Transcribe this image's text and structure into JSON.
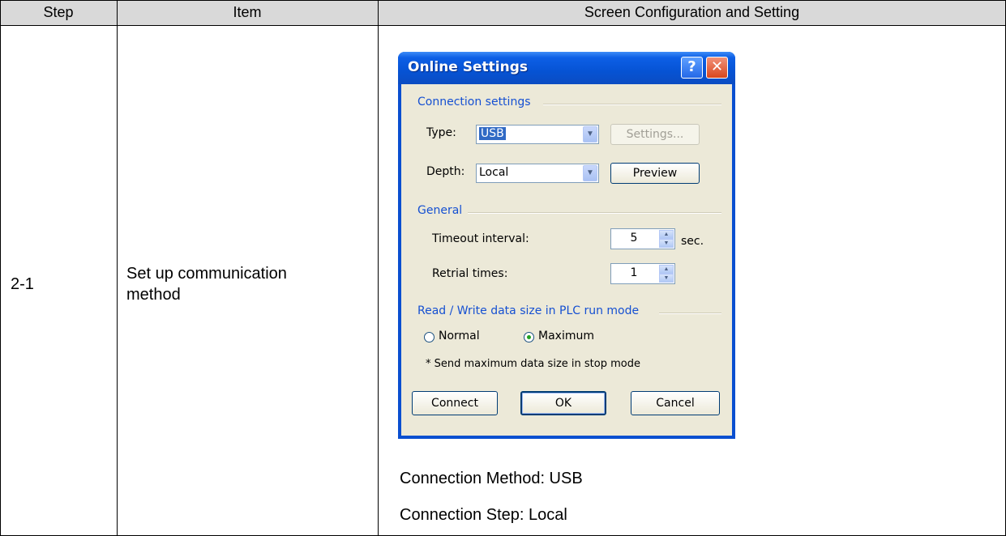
{
  "table": {
    "headers": [
      "Step",
      "Item",
      "Screen Configuration and Setting"
    ],
    "row": {
      "step": "2-1",
      "item_line1": "Set up communication",
      "item_line2": "method",
      "notes": [
        "Connection Method: USB",
        "Connection Step: Local"
      ]
    }
  },
  "dialog": {
    "title": "Online Settings",
    "help_glyph": "?",
    "close_glyph": "✕",
    "connection_settings": {
      "heading": "Connection settings",
      "type_label": "Type:",
      "type_value": "USB",
      "settings_button": "Settings...",
      "depth_label": "Depth:",
      "depth_value": "Local",
      "preview_button": "Preview"
    },
    "general": {
      "heading": "General",
      "timeout_label": "Timeout interval:",
      "timeout_value": "5",
      "timeout_unit": "sec.",
      "retrial_label": "Retrial times:",
      "retrial_value": "1"
    },
    "rw_mode": {
      "heading": "Read / Write data size in PLC run mode",
      "option_normal": "Normal",
      "option_maximum": "Maximum",
      "selected": "Maximum",
      "note": "* Send maximum data size in stop mode"
    },
    "buttons": {
      "connect": "Connect",
      "ok": "OK",
      "cancel": "Cancel"
    },
    "icons": {
      "combo_arrow": "chevron-down-icon",
      "spin_up": "arrow-up-icon",
      "spin_down": "arrow-down-icon"
    }
  },
  "colors": {
    "header_bg": "#d9d9d9",
    "xp_blue": "#0653d4",
    "dialog_bg": "#ece9d8",
    "section_text": "#1550d2"
  }
}
